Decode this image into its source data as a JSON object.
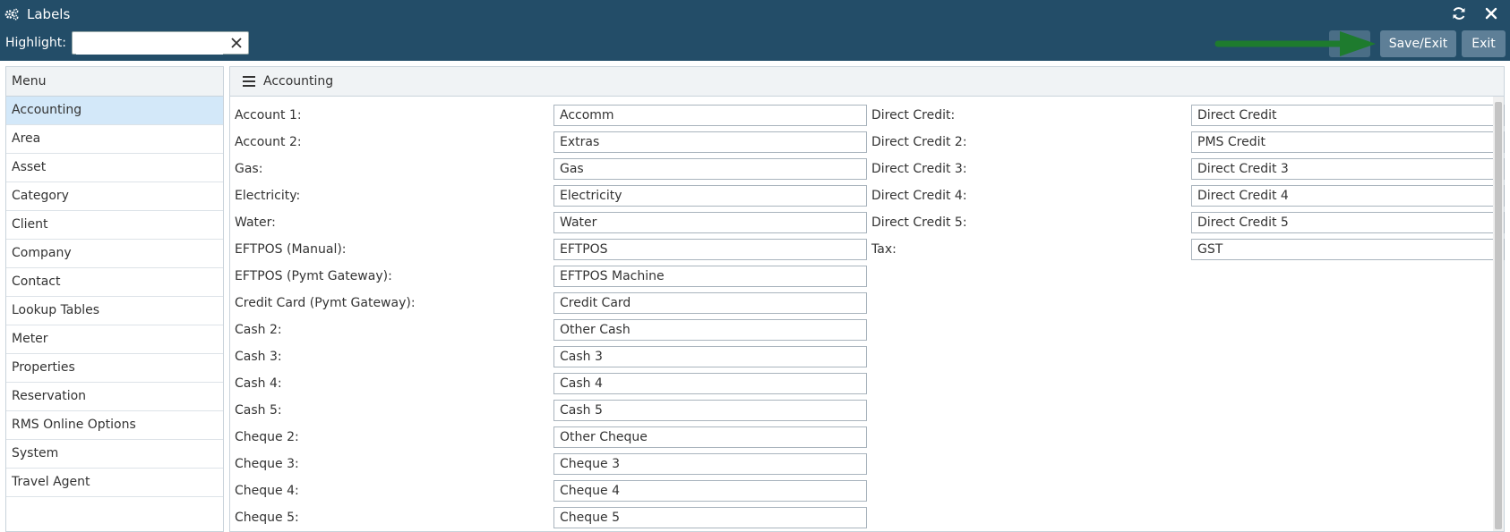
{
  "window": {
    "title": "Labels",
    "icons": {
      "app": "gears-icon",
      "refresh": "refresh-icon",
      "close": "close-icon"
    },
    "colors": {
      "titlebar": "#234d68",
      "button": "#5e7f97",
      "arrow": "#1e7b2e",
      "active_item": "#d3e8f9"
    }
  },
  "highlight": {
    "label": "Highlight:",
    "value": ""
  },
  "toolbar": {
    "save_exit": "Save/Exit",
    "exit": "Exit"
  },
  "menu": {
    "header": "Menu",
    "items": [
      "Accounting",
      "Area",
      "Asset",
      "Category",
      "Client",
      "Company",
      "Contact",
      "Lookup Tables",
      "Meter",
      "Properties",
      "Reservation",
      "RMS Online Options",
      "System",
      "Travel Agent"
    ],
    "active": "Accounting"
  },
  "section": {
    "title": "Accounting",
    "left_fields": [
      {
        "label": "Account 1:",
        "value": "Accomm"
      },
      {
        "label": "Account 2:",
        "value": "Extras"
      },
      {
        "label": "Gas:",
        "value": "Gas"
      },
      {
        "label": "Electricity:",
        "value": "Electricity"
      },
      {
        "label": "Water:",
        "value": "Water"
      },
      {
        "label": "EFTPOS (Manual):",
        "value": "EFTPOS"
      },
      {
        "label": "EFTPOS (Pymt Gateway):",
        "value": "EFTPOS Machine"
      },
      {
        "label": "Credit Card (Pymt Gateway):",
        "value": "Credit Card"
      },
      {
        "label": "Cash 2:",
        "value": "Other Cash"
      },
      {
        "label": "Cash 3:",
        "value": "Cash 3"
      },
      {
        "label": "Cash 4:",
        "value": "Cash 4"
      },
      {
        "label": "Cash 5:",
        "value": "Cash 5"
      },
      {
        "label": "Cheque 2:",
        "value": "Other Cheque"
      },
      {
        "label": "Cheque 3:",
        "value": "Cheque 3"
      },
      {
        "label": "Cheque 4:",
        "value": "Cheque 4"
      },
      {
        "label": "Cheque 5:",
        "value": "Cheque 5"
      }
    ],
    "right_fields": [
      {
        "label": "Direct Credit:",
        "value": "Direct Credit"
      },
      {
        "label": "Direct Credit 2:",
        "value": "PMS Credit"
      },
      {
        "label": "Direct Credit 3:",
        "value": "Direct Credit 3"
      },
      {
        "label": "Direct Credit 4:",
        "value": "Direct Credit 4"
      },
      {
        "label": "Direct Credit 5:",
        "value": "Direct Credit 5"
      },
      {
        "label": "Tax:",
        "value": "GST"
      }
    ]
  }
}
